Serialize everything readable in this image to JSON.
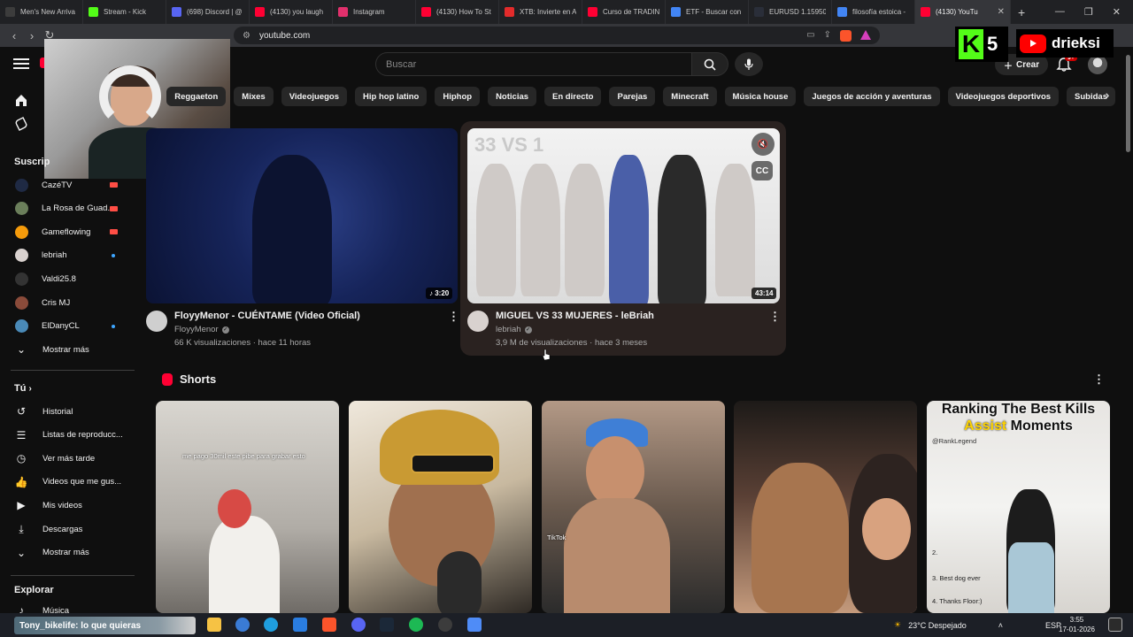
{
  "browser": {
    "tabs": [
      {
        "label": "Men's New Arriva",
        "color": "#3c3c3c"
      },
      {
        "label": "Stream - Kick",
        "color": "#53fc18"
      },
      {
        "label": "(698) Discord | @",
        "color": "#5865f2"
      },
      {
        "label": "(4130) you laugh",
        "color": "#ff0033"
      },
      {
        "label": "Instagram",
        "color": "#e1306c"
      },
      {
        "label": "(4130) How To St",
        "color": "#ff0033"
      },
      {
        "label": "XTB: Invierte en A",
        "color": "#e32b2b"
      },
      {
        "label": "Curso de TRADIN",
        "color": "#ff0033"
      },
      {
        "label": "ETF - Buscar con",
        "color": "#4285f4"
      },
      {
        "label": "EURUSD 1.15950",
        "color": "#2a2e39"
      },
      {
        "label": "filosofía estoica -",
        "color": "#4285f4"
      },
      {
        "label": "(4130) YouTu",
        "color": "#ff0033",
        "active": true
      }
    ],
    "url": "youtube.com"
  },
  "masthead": {
    "search_placeholder": "Buscar",
    "create_label": "Crear",
    "notif_badge": "9+"
  },
  "overlay": {
    "kick_count": "5",
    "yt_username": "drieksi"
  },
  "sidebar": {
    "subs_heading": "Suscrip",
    "subscriptions": [
      {
        "name": "CazéTV",
        "status": "live",
        "color": "#1f2a44"
      },
      {
        "name": "La Rosa de Guad...",
        "status": "live",
        "color": "#6b7f5b"
      },
      {
        "name": "Gameflowing",
        "status": "live",
        "color": "#f59b0b"
      },
      {
        "name": "lebriah",
        "status": "new",
        "color": "#d9d2cf"
      },
      {
        "name": "Valdi25.8",
        "status": "none",
        "color": "#333333"
      },
      {
        "name": "Cris MJ",
        "status": "none",
        "color": "#8a4b3a"
      },
      {
        "name": "ElDanyCL",
        "status": "new",
        "color": "#4a8ab8"
      }
    ],
    "subs_more": "Mostrar más",
    "you_heading": "Tú",
    "you_items": [
      {
        "label": "Historial",
        "icon": "history-icon",
        "glyph": "↺"
      },
      {
        "label": "Listas de reproducc...",
        "icon": "playlists-icon",
        "glyph": "☰"
      },
      {
        "label": "Ver más tarde",
        "icon": "watch-later-icon",
        "glyph": "◷"
      },
      {
        "label": "Videos que me gus...",
        "icon": "like-icon",
        "glyph": "👍"
      },
      {
        "label": "Mis videos",
        "icon": "my-videos-icon",
        "glyph": "▶"
      },
      {
        "label": "Descargas",
        "icon": "download-icon",
        "glyph": "⤓"
      },
      {
        "label": "Mostrar más",
        "icon": "chevron-down-icon",
        "glyph": "⌄"
      }
    ],
    "explore_heading": "Explorar",
    "explore_items": [
      {
        "label": "Música",
        "icon": "music-icon"
      }
    ]
  },
  "chips": [
    "Reggaeton",
    "Mixes",
    "Videojuegos",
    "Hip hop latino",
    "Hiphop",
    "Noticias",
    "En directo",
    "Parejas",
    "Minecraft",
    "Música house",
    "Juegos de acción y aventuras",
    "Videojuegos deportivos",
    "Subidas"
  ],
  "videos": [
    {
      "title": "FloyyMenor - CUÉNTAME (Video Oficial)",
      "channel": "FloyyMenor",
      "meta": "66 K visualizaciones · hace 11 horas",
      "duration": "♪ 3:20",
      "avatar_color": "#cfcfcf"
    },
    {
      "title": "MIGUEL VS 33 MUJERES - leBriah",
      "channel": "lebriah",
      "meta": "3,9 M de visualizaciones · hace 3 meses",
      "duration": "43:14",
      "thumb_tag": "33 VS 1",
      "cc_label": "CC",
      "avatar_color": "#d9d2cf"
    }
  ],
  "shorts": {
    "heading": "Shorts",
    "items": [
      {
        "caption": "me pago 30mil este pibe para grabar esto"
      },
      {
        "caption": ""
      },
      {
        "caption": "TikTok"
      },
      {
        "caption": ""
      },
      {
        "caption_title_a": "Ranking The Best Kills",
        "caption_highlight": "Assist",
        "caption_title_b": " Moments",
        "handle": "@RankLegend",
        "list_2": "2.",
        "list_3": "3. Best dog ever",
        "list_4": "4. Thanks Floor:)"
      }
    ]
  },
  "taskbar": {
    "chat_line": "Tony_bikelife: lo que quieras",
    "weather": "23°C  Despejado",
    "lang": "ESP",
    "time": "3:55",
    "date": "17-01-2026"
  }
}
